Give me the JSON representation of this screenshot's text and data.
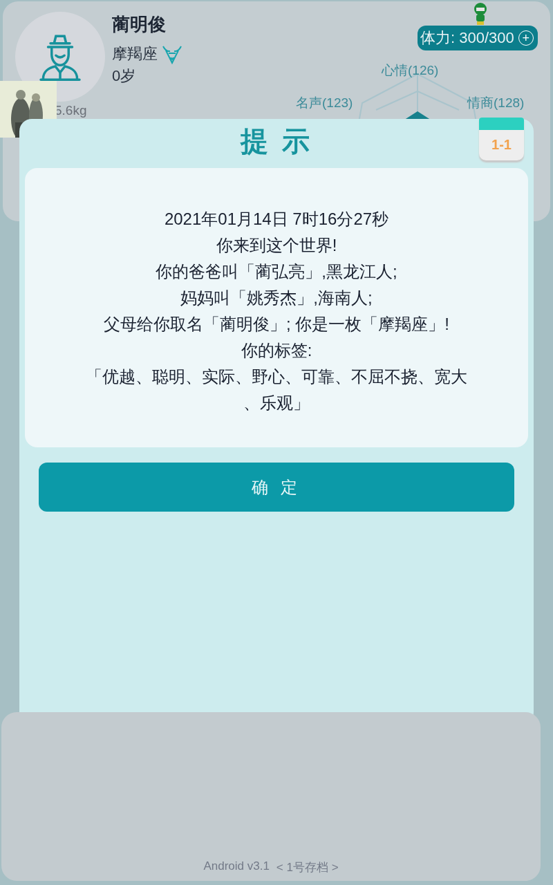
{
  "profile": {
    "name": "蔺明俊",
    "zodiac": "摩羯座",
    "age": "0岁",
    "weight_fragment": "5.6kg"
  },
  "stamina": {
    "label": "体力: 300/300",
    "plus": "+"
  },
  "radar_labels": [
    "心情(126)",
    "名声(123)",
    "情商(128)"
  ],
  "dialog": {
    "title": "提 示",
    "calendar": "1-1",
    "lines": [
      "2021年01月14日 7时16分27秒",
      "你来到这个世界!",
      "你的爸爸叫「蔺弘亮」,黑龙江人;",
      "妈妈叫「姚秀杰」,海南人;",
      "父母给你取名「蔺明俊」; 你是一枚「摩羯座」!",
      "你的标签:",
      "「优越、聪明、实际、野心、可靠、不屈不挠、宽大",
      "、乐观」"
    ],
    "button": "确 定"
  },
  "footer": {
    "version": "Android v3.1",
    "save": "< 1号存档 >"
  }
}
